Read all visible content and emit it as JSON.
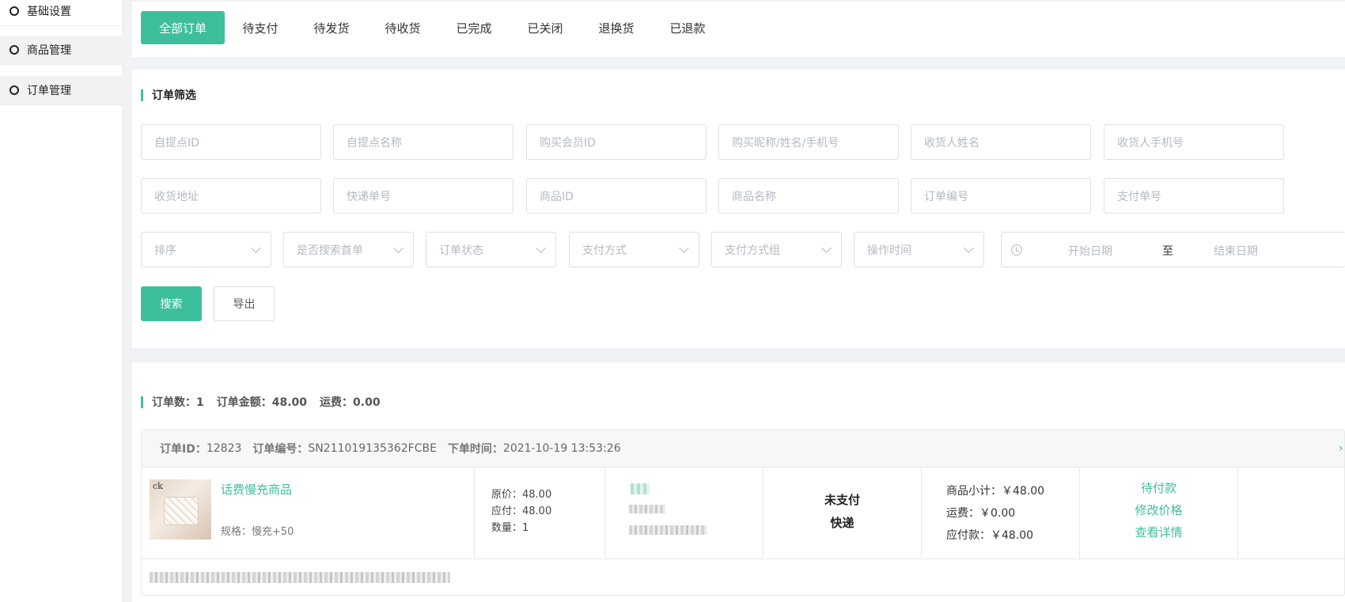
{
  "sidebar": {
    "items": [
      {
        "label": "基础设置"
      },
      {
        "label": "商品管理"
      },
      {
        "label": "订单管理"
      }
    ]
  },
  "tabs": [
    {
      "label": "全部订单",
      "active": true
    },
    {
      "label": "待支付"
    },
    {
      "label": "待发货"
    },
    {
      "label": "待收货"
    },
    {
      "label": "已完成"
    },
    {
      "label": "已关闭"
    },
    {
      "label": "退换货"
    },
    {
      "label": "已退款"
    }
  ],
  "filter": {
    "title": "订单筛选",
    "inputs_row1": [
      "自提点ID",
      "自提点名称",
      "购买会员ID",
      "购买昵称/姓名/手机号",
      "收货人姓名",
      "收货人手机号"
    ],
    "inputs_row2": [
      "收货地址",
      "快递单号",
      "商品ID",
      "商品名称",
      "订单编号",
      "支付单号"
    ],
    "selects": [
      "排序",
      "是否搜索首单",
      "订单状态",
      "支付方式",
      "支付方式组",
      "操作时间"
    ],
    "date_range": {
      "start": "开始日期",
      "sep": "至",
      "end": "结束日期"
    },
    "search_label": "搜索",
    "export_label": "导出"
  },
  "summary": {
    "count": "订单数：1",
    "amount": "订单金额：48.00",
    "freight": "运费：0.00"
  },
  "order": {
    "id_label": "订单ID：",
    "id": "12823",
    "no_label": "订单编号：",
    "no": "SN211019135362FCBE",
    "time_label": "下单时间：",
    "time": "2021-10-19 13:53:26",
    "product": {
      "thumb_logo": "ck",
      "name": "话费慢充商品",
      "spec": "规格：慢充+50"
    },
    "price": {
      "original": "原价：48.00",
      "payable": "应付：48.00",
      "quantity": "数量：1"
    },
    "pay_status": "未支付",
    "delivery": "快递",
    "amounts": {
      "subtotal": "商品小计：￥48.00",
      "freight": "运费：￥0.00",
      "payable": "应付款：￥48.00"
    },
    "actions": {
      "status": "待付款",
      "edit_price": "修改价格",
      "detail": "查看详情"
    }
  },
  "colors": {
    "accent": "#3dbf9d"
  }
}
